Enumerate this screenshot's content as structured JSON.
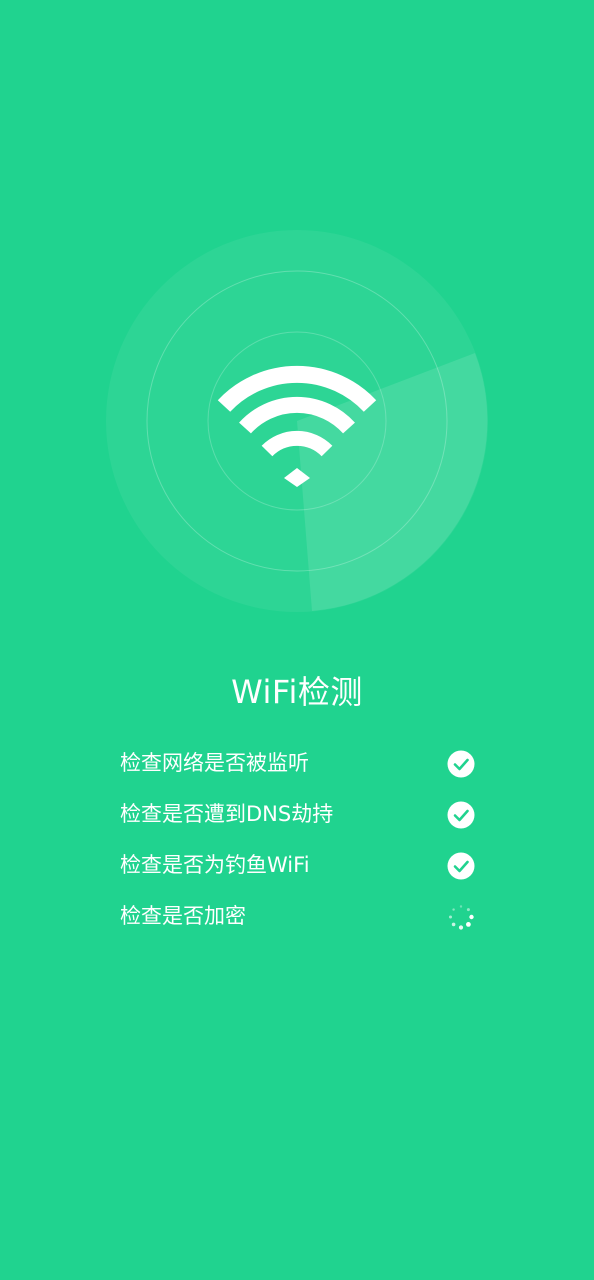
{
  "colors": {
    "background": "#20d38f",
    "ring": "#ffffff",
    "check_fill": "#ffffff",
    "check_mark": "#20d38f"
  },
  "header": {
    "title": "WiFi检测"
  },
  "radar": {
    "center_icon": "wifi-icon",
    "sweep": "radar-sweep"
  },
  "checks": [
    {
      "label": "检查网络是否被监听",
      "status": "done",
      "icon": "check-circle-icon"
    },
    {
      "label": "检查是否遭到DNS劫持",
      "status": "done",
      "icon": "check-circle-icon"
    },
    {
      "label": "检查是否为钓鱼WiFi",
      "status": "done",
      "icon": "check-circle-icon"
    },
    {
      "label": "检查是否加密",
      "status": "loading",
      "icon": "loading-spinner-icon"
    }
  ]
}
